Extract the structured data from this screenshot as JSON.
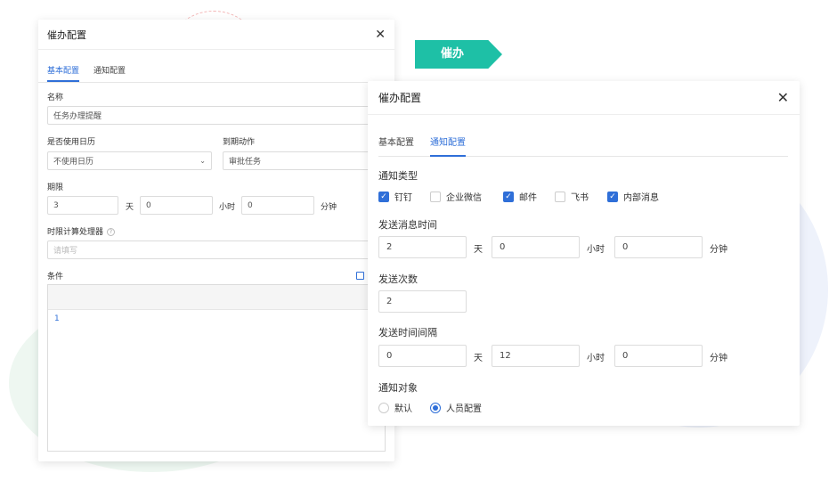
{
  "left": {
    "title": "催办配置",
    "close": "✕",
    "tabs": [
      "基本配置",
      "通知配置"
    ],
    "name_label": "名称",
    "name_value": "任务办理提醒",
    "calendar_label": "是否使用日历",
    "calendar_value": "不使用日历",
    "action_label": "到期动作",
    "action_value": "审批任务",
    "period_label": "期限",
    "period_day": "3",
    "period_hour": "0",
    "period_min": "0",
    "unit_day": "天",
    "unit_hour": "小时",
    "unit_min": "分钟",
    "handler_label": "时限计算处理器",
    "handler_placeholder": "请填写",
    "condition_label": "条件",
    "editor_line": "1"
  },
  "badge": {
    "text": "催办",
    "color": "#1ec0a6"
  },
  "right": {
    "title": "催办配置",
    "close": "✕",
    "tabs": [
      "基本配置",
      "通知配置"
    ],
    "notify_type_label": "通知类型",
    "notify_types": [
      {
        "label": "钉钉",
        "checked": true
      },
      {
        "label": "企业微信",
        "checked": false
      },
      {
        "label": "邮件",
        "checked": true
      },
      {
        "label": "飞书",
        "checked": false
      },
      {
        "label": "内部消息",
        "checked": true
      }
    ],
    "send_time_label": "发送消息时间",
    "send_time_day": "2",
    "send_time_hour": "0",
    "send_time_min": "0",
    "unit_day": "天",
    "unit_hour": "小时",
    "unit_min": "分钟",
    "send_count_label": "发送次数",
    "send_count": "2",
    "interval_label": "发送时间间隔",
    "interval_day": "0",
    "interval_hour": "12",
    "interval_min": "0",
    "target_label": "通知对象",
    "targets": [
      {
        "label": "默认",
        "selected": false
      },
      {
        "label": "人员配置",
        "selected": true
      }
    ]
  },
  "colors": {
    "accent": "#2f6fd8"
  }
}
